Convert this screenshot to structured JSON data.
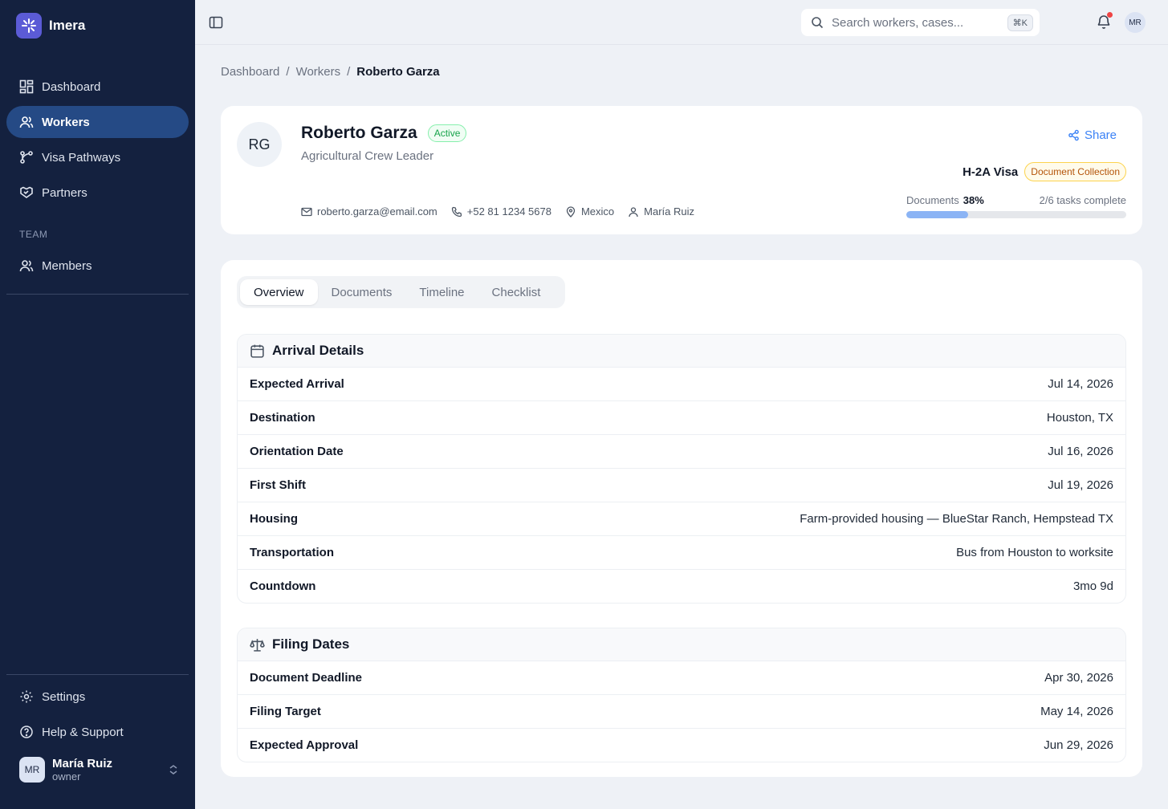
{
  "app": {
    "name": "Imera"
  },
  "sidebar": {
    "items": [
      {
        "label": "Dashboard",
        "icon": "dashboard-icon"
      },
      {
        "label": "Workers",
        "icon": "users-icon",
        "active": true
      },
      {
        "label": "Visa Pathways",
        "icon": "route-icon"
      },
      {
        "label": "Partners",
        "icon": "handshake-icon"
      }
    ],
    "team_label": "TEAM",
    "team_items": [
      {
        "label": "Members",
        "icon": "users-icon"
      }
    ],
    "bottom_items": [
      {
        "label": "Settings",
        "icon": "gear-icon"
      },
      {
        "label": "Help & Support",
        "icon": "help-icon"
      }
    ],
    "user": {
      "initials": "MR",
      "name": "María Ruiz",
      "role": "owner"
    }
  },
  "topbar": {
    "search_placeholder": "Search workers, cases...",
    "shortcut": "⌘K",
    "avatar_initials": "MR"
  },
  "breadcrumb": {
    "items": [
      "Dashboard",
      "Workers"
    ],
    "current": "Roberto Garza"
  },
  "worker": {
    "initials": "RG",
    "name": "Roberto Garza",
    "status": "Active",
    "role": "Agricultural Crew Leader",
    "share_label": "Share",
    "visa": "H-2A Visa",
    "stage": "Document Collection",
    "email": "roberto.garza@email.com",
    "phone": "+52 81 1234 5678",
    "country": "Mexico",
    "owner": "María Ruiz",
    "documents_label": "Documents",
    "documents_percent": "38%",
    "documents_fraction": 0.28,
    "tasks_text": "2/6 tasks complete"
  },
  "tabs": [
    "Overview",
    "Documents",
    "Timeline",
    "Checklist"
  ],
  "arrival": {
    "title": "Arrival Details",
    "rows": [
      {
        "label": "Expected Arrival",
        "value": "Jul 14, 2026"
      },
      {
        "label": "Destination",
        "value": "Houston, TX"
      },
      {
        "label": "Orientation Date",
        "value": "Jul 16, 2026"
      },
      {
        "label": "First Shift",
        "value": "Jul 19, 2026"
      },
      {
        "label": "Housing",
        "value": "Farm-provided housing — BlueStar Ranch, Hempstead TX"
      },
      {
        "label": "Transportation",
        "value": "Bus from Houston to worksite"
      },
      {
        "label": "Countdown",
        "value": "3mo 9d"
      }
    ]
  },
  "filing": {
    "title": "Filing Dates",
    "rows": [
      {
        "label": "Document Deadline",
        "value": "Apr 30, 2026"
      },
      {
        "label": "Filing Target",
        "value": "May 14, 2026"
      },
      {
        "label": "Expected Approval",
        "value": "Jun 29, 2026"
      }
    ]
  },
  "colors": {
    "sidebar": "#14213f",
    "active_nav": "#254a85",
    "accent": "#3b82f6",
    "success": "#16a34a",
    "warning": "#b45309"
  }
}
